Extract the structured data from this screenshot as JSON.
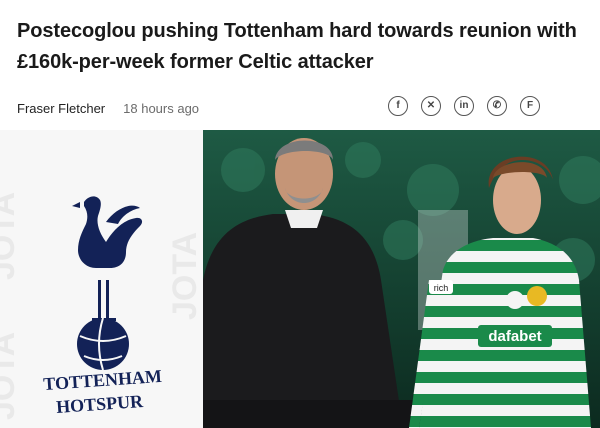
{
  "article": {
    "headline": "Postecoglou pushing Tottenham hard towards reunion with £160k-per-week former Celtic attacker",
    "author": "Fraser Fletcher",
    "time": "18 hours ago"
  },
  "share": [
    {
      "name": "facebook-share-button",
      "glyph": "f"
    },
    {
      "name": "x-share-button",
      "glyph": "✕"
    },
    {
      "name": "linkedin-share-button",
      "glyph": "in"
    },
    {
      "name": "whatsapp-share-button",
      "glyph": "✆"
    },
    {
      "name": "flipboard-share-button",
      "glyph": "F"
    }
  ],
  "crest": {
    "line1": "TOTTENHAM",
    "line2": "HOTSPUR",
    "watermark": "JOTA",
    "navy": "#132257"
  },
  "photo": {
    "shirt_sponsor": "dafabet",
    "sleeve_patch": "rich",
    "celtic_green": "#1a8a4a"
  }
}
